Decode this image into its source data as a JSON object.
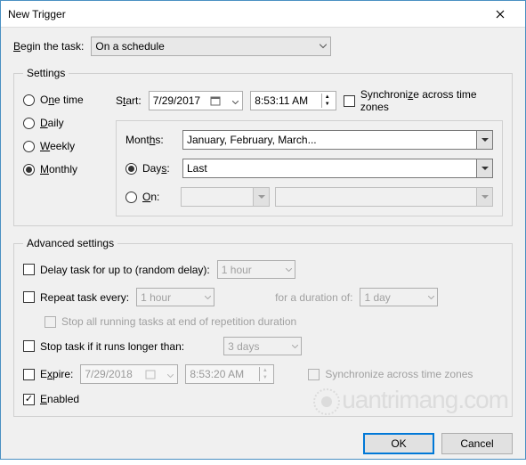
{
  "window": {
    "title": "New Trigger"
  },
  "begin": {
    "label": "Begin the task:",
    "value": "On a schedule"
  },
  "settings": {
    "legend": "Settings",
    "recurrence": {
      "one_time": "One time",
      "daily": "Daily",
      "weekly": "Weekly",
      "monthly": "Monthly"
    },
    "start_label": "Start:",
    "start_date": "7/29/2017",
    "start_time": "8:53:11 AM",
    "sync_tz": "Synchronize across time zones",
    "monthly": {
      "months_label": "Months:",
      "months_value": "January, February, March...",
      "days_label": "Days:",
      "days_value": "Last",
      "on_label": "On:"
    }
  },
  "advanced": {
    "legend": "Advanced settings",
    "delay_label": "Delay task for up to (random delay):",
    "delay_value": "1 hour",
    "repeat_label": "Repeat task every:",
    "repeat_value": "1 hour",
    "duration_label": "for a duration of:",
    "duration_value": "1 day",
    "stop_repetition": "Stop all running tasks at end of repetition duration",
    "stop_long_label": "Stop task if it runs longer than:",
    "stop_long_value": "3 days",
    "expire_label": "Expire:",
    "expire_date": "7/29/2018",
    "expire_time": "8:53:20 AM",
    "expire_sync": "Synchronize across time zones",
    "enabled_label": "Enabled"
  },
  "buttons": {
    "ok": "OK",
    "cancel": "Cancel"
  },
  "watermark": "uantrimang.com"
}
